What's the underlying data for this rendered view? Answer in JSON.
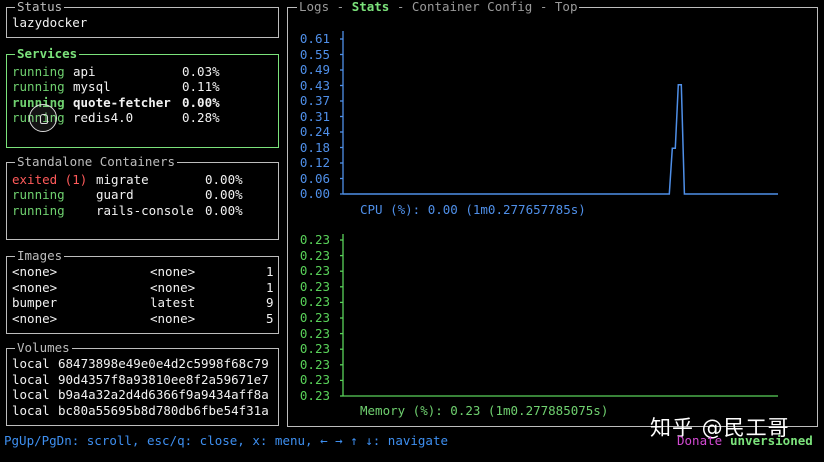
{
  "status": {
    "title": "Status",
    "value": "lazydocker"
  },
  "services": {
    "title": "Services",
    "rows": [
      {
        "state": "running",
        "name": "api",
        "cpu": "0.03%"
      },
      {
        "state": "running",
        "name": "mysql",
        "cpu": "0.11%"
      },
      {
        "state": "running",
        "name": "quote-fetcher",
        "cpu": "0.00%"
      },
      {
        "state": "running",
        "name": "redis4.0",
        "cpu": "0.28%"
      }
    ]
  },
  "standalone": {
    "title": "Standalone Containers",
    "rows": [
      {
        "state": "exited (1)",
        "name": "migrate",
        "cpu": "0.00%"
      },
      {
        "state": "running",
        "name": "guard",
        "cpu": "0.00%"
      },
      {
        "state": "running",
        "name": "rails-console",
        "cpu": "0.00%"
      }
    ]
  },
  "images": {
    "title": "Images",
    "rows": [
      {
        "repo": "<none>",
        "tag": "<none>",
        "size": "1"
      },
      {
        "repo": "<none>",
        "tag": "<none>",
        "size": "1"
      },
      {
        "repo": "bumper",
        "tag": "latest",
        "size": "9"
      },
      {
        "repo": "<none>",
        "tag": "<none>",
        "size": "5"
      }
    ]
  },
  "volumes": {
    "title": "Volumes",
    "rows": [
      {
        "driver": "local",
        "name": "68473898e49e0e4d2c5998f68c79"
      },
      {
        "driver": "local",
        "name": "90d4357f8a93810ee8f2a59671e7"
      },
      {
        "driver": "local",
        "name": "b9a4a32a2d4d6366f9a9434aff8a"
      },
      {
        "driver": "local",
        "name": "bc80a55695b8d780db6fbe54f31a"
      }
    ]
  },
  "main": {
    "tabs": [
      "Logs",
      "Stats",
      "Container Config",
      "Top"
    ],
    "tab_sep": " - ",
    "active_tab": "Stats"
  },
  "cpu_chart": {
    "color": "#4f8fe8",
    "y_ticks": [
      "0.61",
      "0.55",
      "0.49",
      "0.43",
      "0.37",
      "0.31",
      "0.24",
      "0.18",
      "0.12",
      "0.06",
      "0.00"
    ],
    "caption": "CPU (%): 0.00 (1m0.277657785s)",
    "series": [
      0,
      0,
      0,
      0,
      0,
      0,
      0,
      0,
      0,
      0,
      0,
      0,
      0,
      0,
      0,
      0,
      0,
      0,
      0,
      0,
      0,
      0,
      0,
      0,
      0,
      0,
      0,
      0,
      0,
      0,
      0,
      0,
      0,
      0,
      0,
      0,
      0,
      0,
      0,
      0,
      0,
      0,
      0,
      0,
      0,
      0,
      0,
      0,
      0,
      0,
      0,
      0,
      0,
      0,
      0,
      0,
      0,
      0,
      0,
      0,
      0,
      0,
      0,
      0,
      0,
      0,
      0,
      0,
      0,
      0,
      0,
      0,
      0,
      0,
      0,
      0,
      0,
      0,
      0,
      0,
      0,
      0,
      0,
      0,
      0,
      0,
      0,
      0,
      0,
      0,
      0,
      0,
      0,
      0,
      0,
      0,
      0,
      0,
      0,
      0,
      0,
      0,
      0,
      0,
      0,
      0,
      0,
      0,
      0,
      0.18,
      0.18,
      0.43,
      0.43,
      0,
      0,
      0,
      0,
      0,
      0,
      0,
      0,
      0,
      0,
      0,
      0,
      0,
      0,
      0,
      0,
      0,
      0,
      0,
      0,
      0,
      0,
      0,
      0,
      0,
      0,
      0,
      0,
      0,
      0,
      0,
      0
    ]
  },
  "mem_chart": {
    "color": "#59d159",
    "y_ticks": [
      "0.23",
      "0.23",
      "0.23",
      "0.23",
      "0.23",
      "0.23",
      "0.23",
      "0.23",
      "0.23",
      "0.23",
      "0.23"
    ],
    "caption": "Memory (%): 0.23 (1m0.277885075s)",
    "value": 0.23
  },
  "footer": {
    "help": "PgUp/PgDn: scroll, esc/q: close, x: menu, ← → ↑ ↓: navigate",
    "donate": "Donate",
    "version": "unversioned"
  },
  "watermark": "知乎 @民工哥"
}
